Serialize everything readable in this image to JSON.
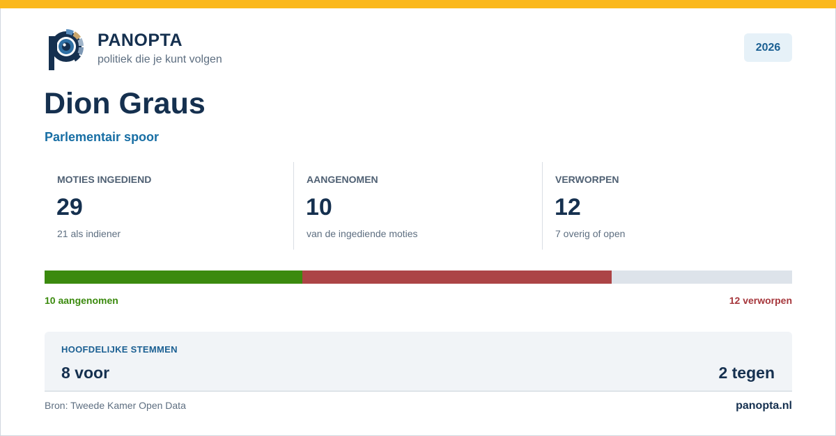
{
  "brand": {
    "name": "PANOPTA",
    "tagline": "politiek die je kunt volgen",
    "accent_color": "#fbb81c",
    "navy_color": "#15304f",
    "logo_icon": "panopta-eye-logo-icon"
  },
  "year_badge": "2026",
  "person": {
    "name": "Dion Graus",
    "subtitle": "Parlementair spoor"
  },
  "stats": [
    {
      "label": "MOTIES INGEDIEND",
      "value": "29",
      "sub": "21 als indiener"
    },
    {
      "label": "AANGENOMEN",
      "value": "10",
      "sub": "van de ingediende moties"
    },
    {
      "label": "VERWORPEN",
      "value": "12",
      "sub": "7 overig of open"
    }
  ],
  "progress": {
    "total": 29,
    "accepted": 10,
    "rejected": 12,
    "accepted_color": "#3b8a0e",
    "rejected_color": "#ac4446",
    "rest_color": "#dde3ea",
    "left_label": "10 aangenomen",
    "right_label": "12 verworpen"
  },
  "votes": {
    "title": "HOOFDELIJKE STEMMEN",
    "for": "8 voor",
    "against": "2 tegen"
  },
  "footer": {
    "source": "Bron: Tweede Kamer Open Data",
    "site": "panopta.nl"
  }
}
